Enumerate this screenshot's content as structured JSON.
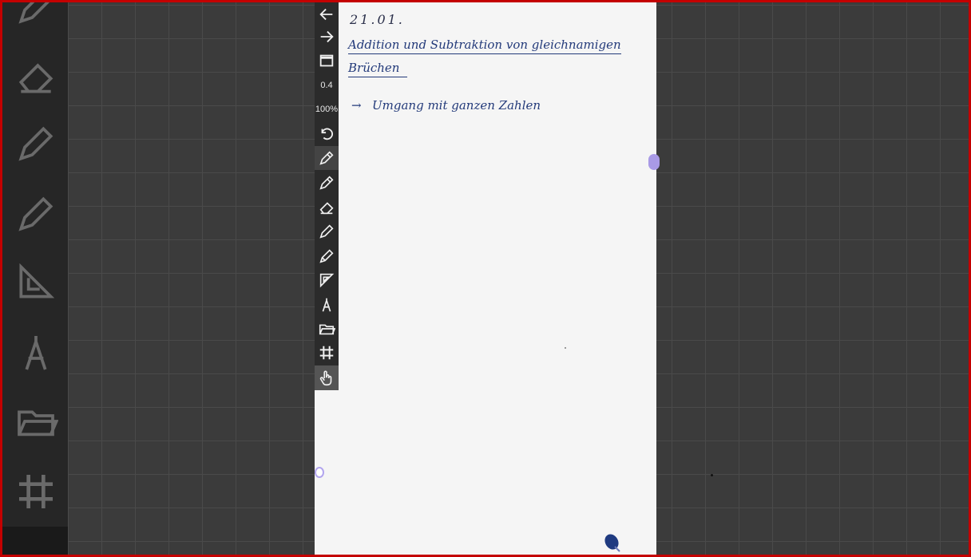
{
  "note": {
    "date": "21.01.",
    "title_line1": "Addition und Subtraktion von gleichnamigen",
    "title_line2": "Brüchen",
    "arrow": "→",
    "bullet_text": "Umgang mit ganzen Zahlen"
  },
  "toolbar": {
    "stroke_width": "0.4",
    "zoom": "100%",
    "icons": [
      "arrow-left-icon",
      "arrow-right-icon",
      "window-icon",
      "undo-icon",
      "fountain-pen-icon",
      "pencil-icon",
      "eraser-icon",
      "pen-icon",
      "highlighter-icon",
      "set-square-icon",
      "compass-icon",
      "folder-icon",
      "grid-icon",
      "hand-pointer-icon"
    ]
  },
  "colors": {
    "ink": "#233a7a",
    "toolbar": "#2b2b2b",
    "accent": "#a99ae6",
    "frame": "#c40000"
  }
}
